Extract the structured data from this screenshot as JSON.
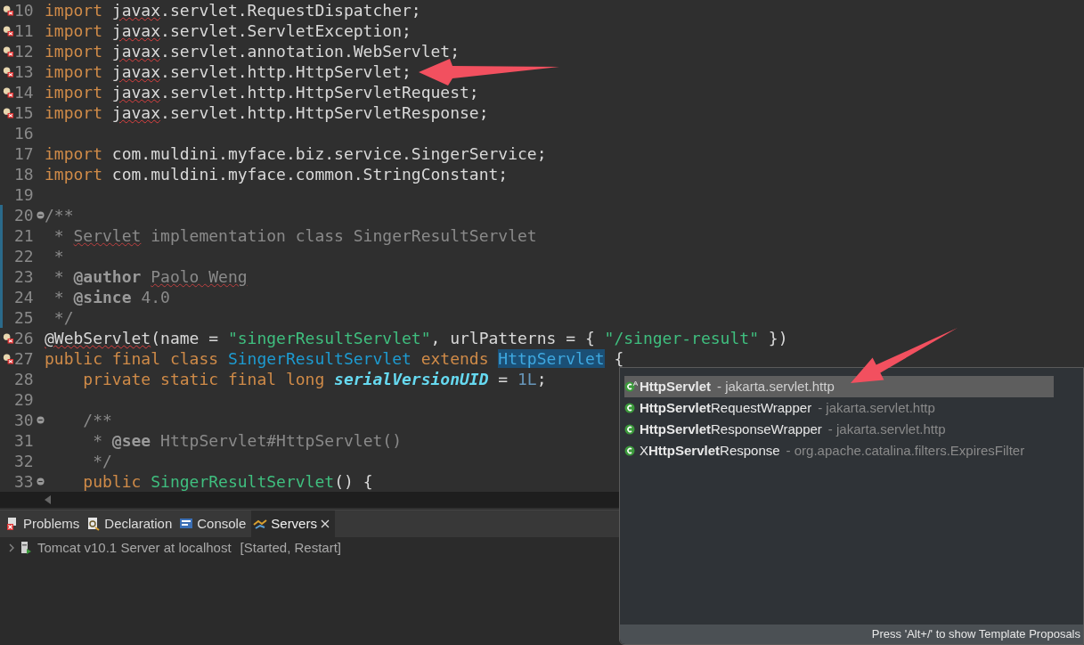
{
  "editor": {
    "lines": [
      {
        "number": "10",
        "error": true,
        "fold": false,
        "changed": false,
        "tokens": [
          {
            "kind": "keyword",
            "text": "import "
          },
          {
            "kind": "error",
            "text": "javax"
          },
          {
            "kind": "plain",
            "text": ".servlet.RequestDispatcher;"
          }
        ]
      },
      {
        "number": "11",
        "error": true,
        "fold": false,
        "changed": false,
        "tokens": [
          {
            "kind": "keyword",
            "text": "import "
          },
          {
            "kind": "error",
            "text": "javax"
          },
          {
            "kind": "plain",
            "text": ".servlet.ServletException;"
          }
        ]
      },
      {
        "number": "12",
        "error": true,
        "fold": false,
        "changed": false,
        "tokens": [
          {
            "kind": "keyword",
            "text": "import "
          },
          {
            "kind": "error",
            "text": "javax"
          },
          {
            "kind": "plain",
            "text": ".servlet.annotation.WebServlet;"
          }
        ]
      },
      {
        "number": "13",
        "error": true,
        "fold": false,
        "changed": false,
        "tokens": [
          {
            "kind": "keyword",
            "text": "import "
          },
          {
            "kind": "error",
            "text": "javax"
          },
          {
            "kind": "plain",
            "text": ".servlet.http.HttpServlet;"
          }
        ]
      },
      {
        "number": "14",
        "error": true,
        "fold": false,
        "changed": false,
        "tokens": [
          {
            "kind": "keyword",
            "text": "import "
          },
          {
            "kind": "error",
            "text": "javax"
          },
          {
            "kind": "plain",
            "text": ".servlet.http.HttpServletRequest;"
          }
        ]
      },
      {
        "number": "15",
        "error": true,
        "fold": false,
        "changed": false,
        "tokens": [
          {
            "kind": "keyword",
            "text": "import "
          },
          {
            "kind": "error",
            "text": "javax"
          },
          {
            "kind": "plain",
            "text": ".servlet.http.HttpServletResponse;"
          }
        ]
      },
      {
        "number": "16",
        "error": false,
        "fold": false,
        "changed": false
      },
      {
        "number": "17",
        "error": false,
        "fold": false,
        "changed": false,
        "tokens": [
          {
            "kind": "keyword",
            "text": "import "
          },
          {
            "kind": "plain",
            "text": "com.muldini.myface.biz.service.SingerService;"
          }
        ]
      },
      {
        "number": "18",
        "error": false,
        "fold": false,
        "changed": false,
        "tokens": [
          {
            "kind": "keyword",
            "text": "import "
          },
          {
            "kind": "plain",
            "text": "com.muldini.myface.common.StringConstant;"
          }
        ]
      },
      {
        "number": "19",
        "error": false,
        "fold": false,
        "changed": false
      },
      {
        "number": "20",
        "error": false,
        "fold": true,
        "changed": true,
        "tokens": [
          {
            "kind": "comment",
            "text": "/**"
          }
        ]
      },
      {
        "number": "21",
        "error": false,
        "fold": false,
        "changed": true,
        "tokens": [
          {
            "kind": "comment",
            "text": " * "
          },
          {
            "kind": "spelling",
            "text": "Servlet"
          },
          {
            "kind": "comment",
            "text": " implementation class SingerResultServlet"
          }
        ]
      },
      {
        "number": "22",
        "error": false,
        "fold": false,
        "changed": true,
        "tokens": [
          {
            "kind": "comment",
            "text": " *"
          }
        ]
      },
      {
        "number": "23",
        "error": false,
        "fold": false,
        "changed": true,
        "tokens": [
          {
            "kind": "comment",
            "text": " * "
          },
          {
            "kind": "tag",
            "text": "@author "
          },
          {
            "kind": "spelling",
            "text": "Paolo Weng"
          }
        ]
      },
      {
        "number": "24",
        "error": false,
        "fold": false,
        "changed": true,
        "tokens": [
          {
            "kind": "comment",
            "text": " * "
          },
          {
            "kind": "tag",
            "text": "@since"
          },
          {
            "kind": "comment",
            "text": " 4.0"
          }
        ]
      },
      {
        "number": "25",
        "error": false,
        "fold": false,
        "changed": true,
        "tokens": [
          {
            "kind": "comment",
            "text": " */"
          }
        ]
      },
      {
        "number": "26",
        "error": true,
        "fold": false,
        "changed": false,
        "tokens": [
          {
            "kind": "error",
            "text": "@WebServlet"
          },
          {
            "kind": "plain",
            "text": "(name = "
          },
          {
            "kind": "string",
            "text": "\"singerResultServlet\""
          },
          {
            "kind": "plain",
            "text": ", urlPatterns = { "
          },
          {
            "kind": "string",
            "text": "\"/singer-result\""
          },
          {
            "kind": "plain",
            "text": " })"
          }
        ]
      },
      {
        "number": "27",
        "error": true,
        "fold": false,
        "changed": false,
        "tokens": [
          {
            "kind": "keyword",
            "text": "public final class "
          },
          {
            "kind": "class",
            "text": "SingerResultServlet"
          },
          {
            "kind": "keyword",
            "text": " extends "
          },
          {
            "kind": "selected",
            "text": "HttpServlet"
          },
          {
            "kind": "plain",
            "text": " {"
          }
        ]
      },
      {
        "number": "28",
        "error": false,
        "fold": false,
        "changed": false,
        "tokens": [
          {
            "kind": "keyword",
            "text": "    private static final long "
          },
          {
            "kind": "field",
            "text": "serialVersionUID"
          },
          {
            "kind": "plain",
            "text": " = "
          },
          {
            "kind": "number",
            "text": "1L"
          },
          {
            "kind": "plain",
            "text": ";"
          }
        ]
      },
      {
        "number": "29",
        "error": false,
        "fold": false,
        "changed": false
      },
      {
        "number": "30",
        "error": false,
        "fold": true,
        "changed": false,
        "tokens": [
          {
            "kind": "comment",
            "text": "    /**"
          }
        ]
      },
      {
        "number": "31",
        "error": false,
        "fold": false,
        "changed": false,
        "tokens": [
          {
            "kind": "comment",
            "text": "     * "
          },
          {
            "kind": "tag",
            "text": "@see"
          },
          {
            "kind": "comment",
            "text": " HttpServlet#HttpServlet()"
          }
        ]
      },
      {
        "number": "32",
        "error": false,
        "fold": false,
        "changed": false,
        "tokens": [
          {
            "kind": "comment",
            "text": "     */"
          }
        ]
      },
      {
        "number": "33",
        "error": false,
        "fold": true,
        "changed": false,
        "tokens": [
          {
            "kind": "keyword",
            "text": "    public "
          },
          {
            "kind": "method",
            "text": "SingerResultServlet"
          },
          {
            "kind": "plain",
            "text": "() {"
          }
        ]
      }
    ]
  },
  "bottom_panel": {
    "tabs": [
      {
        "label": "Problems",
        "kind": "problems",
        "selected": false
      },
      {
        "label": "Declaration",
        "kind": "declaration",
        "selected": false
      },
      {
        "label": "Console",
        "kind": "console",
        "selected": false
      },
      {
        "label": "Servers",
        "kind": "servers",
        "selected": true
      }
    ],
    "servers": [
      {
        "label": "Tomcat v10.1 Server at localhost",
        "status": "[Started, Restart]"
      }
    ]
  },
  "completion_popup": {
    "items": [
      {
        "name": "**HttpServlet**",
        "package": "- jakarta.servlet.http",
        "kind": "class-default",
        "selected": true
      },
      {
        "name": "**HttpServlet**RequestWrapper",
        "package": "- jakarta.servlet.http",
        "kind": "class",
        "selected": false
      },
      {
        "name": "**HttpServlet**ResponseWrapper",
        "package": "- jakarta.servlet.http",
        "kind": "class",
        "selected": false
      },
      {
        "name": "X**HttpServlet**Response",
        "package": "- org.apache.catalina.filters.ExpiresFilter",
        "kind": "class",
        "selected": false
      }
    ],
    "footer": "Press 'Alt+/' to show Template Proposals"
  }
}
